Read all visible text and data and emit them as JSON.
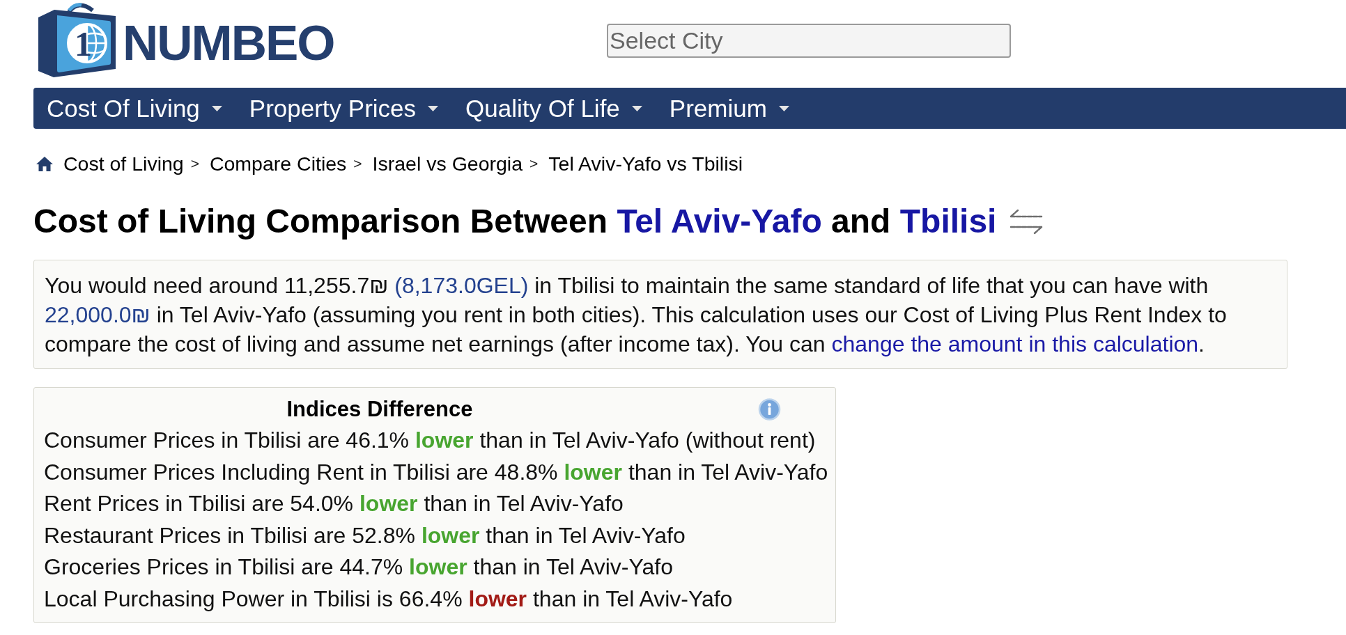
{
  "header": {
    "logo": {
      "numeral": "1",
      "wordmark": "NUMBEO"
    },
    "city_search": {
      "placeholder": "Select City"
    }
  },
  "nav": [
    {
      "label": "Cost Of Living"
    },
    {
      "label": "Property Prices"
    },
    {
      "label": "Quality Of Life"
    },
    {
      "label": "Premium"
    }
  ],
  "breadcrumb": [
    {
      "kind": "link",
      "text": "Cost of Living"
    },
    {
      "kind": "separator",
      "text": ">"
    },
    {
      "kind": "link",
      "text": "Compare Cities"
    },
    {
      "kind": "separator",
      "text": ">"
    },
    {
      "kind": "link",
      "text": "Israel vs Georgia"
    },
    {
      "kind": "separator",
      "text": ">"
    },
    {
      "kind": "link",
      "text": "Tel Aviv-Yafo vs Tbilisi"
    }
  ],
  "title": {
    "parts": [
      {
        "kind": "text",
        "text": "Cost of Living Comparison Between "
      },
      {
        "kind": "city",
        "text": "Tel Aviv-Yafo"
      },
      {
        "kind": "text",
        "text": " and "
      },
      {
        "kind": "city",
        "text": "Tbilisi"
      }
    ]
  },
  "summary": {
    "parts": [
      {
        "kind": "text",
        "text": "You would need around 11,255.7₪ "
      },
      {
        "kind": "amount",
        "text": "(8,173.0GEL)"
      },
      {
        "kind": "text",
        "text": " in Tbilisi to maintain the same standard of life that you can have with "
      },
      {
        "kind": "amount",
        "text": "22,000.0₪"
      },
      {
        "kind": "text",
        "text": " in Tel Aviv-Yafo (assuming you rent in both cities). This calculation uses our Cost of Living Plus Rent Index to compare the cost of living and assume net earnings (after income tax). You can "
      },
      {
        "kind": "link",
        "text": "change the amount in this calculation"
      },
      {
        "kind": "text",
        "text": "."
      }
    ]
  },
  "indices": {
    "title": "Indices Difference",
    "rows": [
      {
        "before": "Consumer Prices in Tbilisi are 46.1% ",
        "emphasis": "lower",
        "color": "#48a530",
        "after": " than in Tel Aviv-Yafo (without rent)"
      },
      {
        "before": "Consumer Prices Including Rent in Tbilisi are 48.8% ",
        "emphasis": "lower",
        "color": "#48a530",
        "after": " than in Tel Aviv-Yafo"
      },
      {
        "before": "Rent Prices in Tbilisi are 54.0% ",
        "emphasis": "lower",
        "color": "#48a530",
        "after": " than in Tel Aviv-Yafo"
      },
      {
        "before": "Restaurant Prices in Tbilisi are 52.8% ",
        "emphasis": "lower",
        "color": "#48a530",
        "after": " than in Tel Aviv-Yafo"
      },
      {
        "before": "Groceries Prices in Tbilisi are 44.7% ",
        "emphasis": "lower",
        "color": "#48a530",
        "after": " than in Tel Aviv-Yafo"
      },
      {
        "before": "Local Purchasing Power in Tbilisi is 66.4% ",
        "emphasis": "lower",
        "color": "#a21b16",
        "after": " than in Tel Aviv-Yafo"
      }
    ]
  }
}
